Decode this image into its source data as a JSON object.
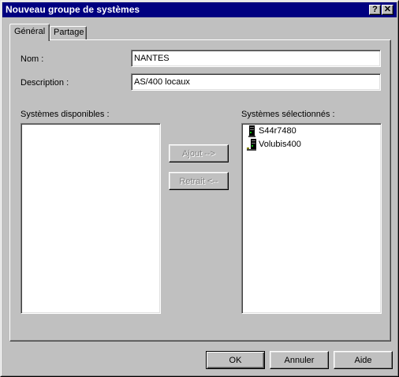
{
  "window": {
    "title": "Nouveau groupe de systèmes",
    "help_glyph": "?",
    "close_glyph": "✕"
  },
  "tabs": [
    {
      "label": "Général",
      "active": true
    },
    {
      "label": "Partage",
      "active": false
    }
  ],
  "form": {
    "name_label": "Nom :",
    "name_value": "NANTES",
    "description_label": "Description :",
    "description_value": "AS/400 locaux"
  },
  "available": {
    "label": "Systèmes disponibles :",
    "items": []
  },
  "selected": {
    "label": "Systèmes sélectionnés :",
    "items": [
      {
        "label": "S44r7480",
        "icon": "as400-system-icon"
      },
      {
        "label": "Volubis400",
        "icon": "as400-system-icon"
      }
    ]
  },
  "move_buttons": {
    "add_label": "Ajout -->",
    "remove_label": "Retrait <--"
  },
  "footer": {
    "ok_label": "OK",
    "cancel_label": "Annuler",
    "help_label": "Aide"
  }
}
